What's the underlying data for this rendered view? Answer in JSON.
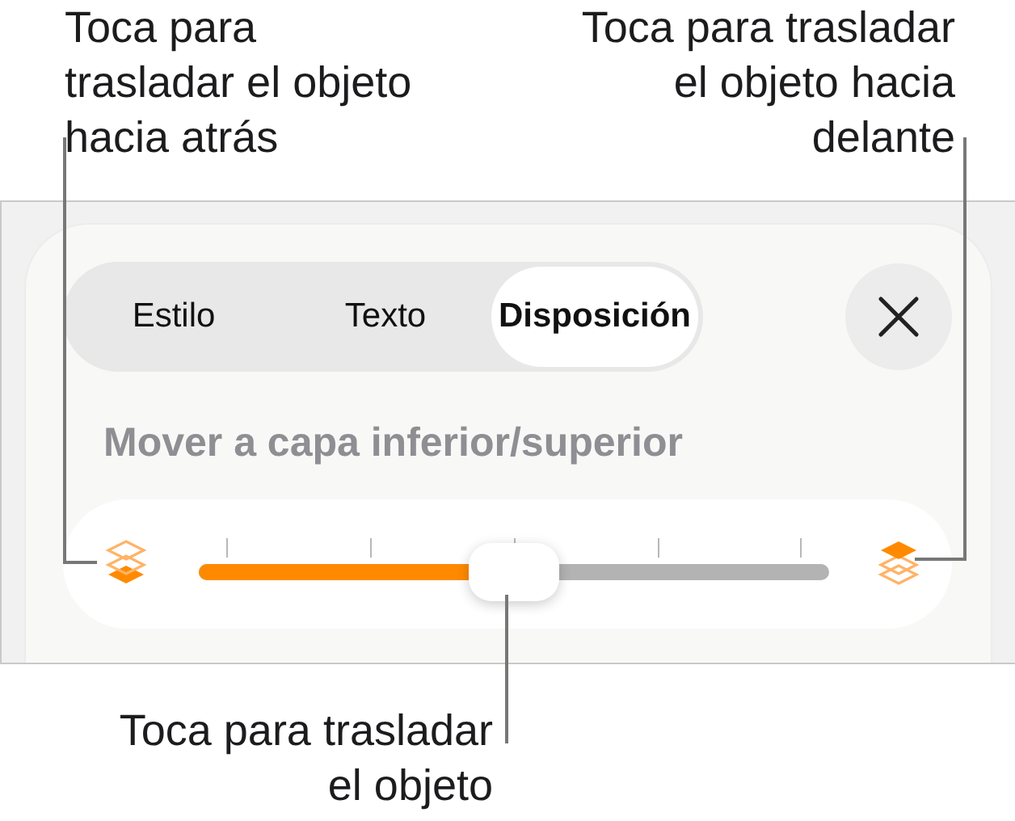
{
  "callout_left": {
    "lines": [
      "Toca para",
      "trasladar el objeto",
      "hacia atrás"
    ]
  },
  "callout_right": {
    "lines": [
      "Toca para trasladar",
      "el objeto hacia",
      "delante"
    ]
  },
  "callout_bottom": {
    "lines": [
      "Toca para trasladar",
      "el objeto"
    ]
  },
  "tabs": [
    {
      "label": "Estilo",
      "selected": false
    },
    {
      "label": "Texto",
      "selected": false
    },
    {
      "label": "Disposición",
      "selected": true
    }
  ],
  "section_title": "Mover a capa inferior/superior",
  "slider": {
    "level": 0.5
  }
}
